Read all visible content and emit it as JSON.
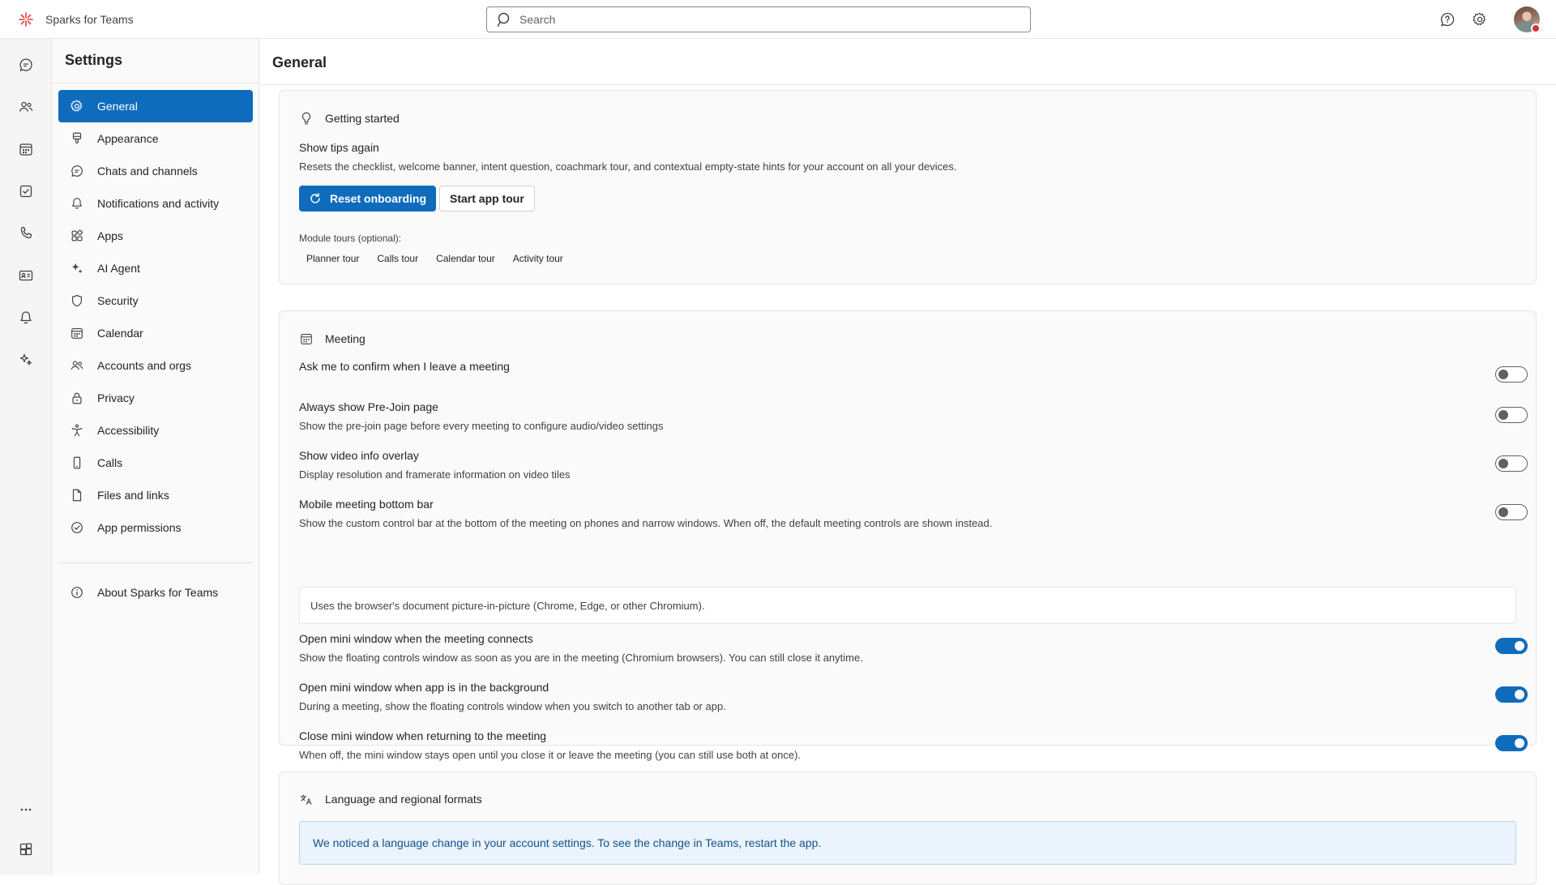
{
  "app": {
    "name": "Sparks for Teams"
  },
  "search": {
    "placeholder": "Search"
  },
  "settings_nav": {
    "title": "Settings",
    "items": [
      {
        "label": "General",
        "icon": "gear-icon",
        "active": true
      },
      {
        "label": "Appearance",
        "icon": "paintbrush-icon"
      },
      {
        "label": "Chats and channels",
        "icon": "chat-icon"
      },
      {
        "label": "Notifications and activity",
        "icon": "bell-icon"
      },
      {
        "label": "Apps",
        "icon": "apps-grid-icon"
      },
      {
        "label": "AI Agent",
        "icon": "sparkle-icon"
      },
      {
        "label": "Security",
        "icon": "shield-icon"
      },
      {
        "label": "Calendar",
        "icon": "calendar-icon"
      },
      {
        "label": "Accounts and orgs",
        "icon": "people-icon"
      },
      {
        "label": "Privacy",
        "icon": "lock-icon"
      },
      {
        "label": "Accessibility",
        "icon": "accessibility-icon"
      },
      {
        "label": "Calls",
        "icon": "phone-icon"
      },
      {
        "label": "Files and links",
        "icon": "document-icon"
      },
      {
        "label": "App permissions",
        "icon": "checkmark-circle-icon"
      }
    ],
    "about": {
      "label": "About Sparks for Teams",
      "icon": "info-icon"
    }
  },
  "main": {
    "title": "General"
  },
  "getting_started": {
    "heading": "Getting started",
    "tips_title": "Show tips again",
    "tips_desc": "Resets the checklist, welcome banner, intent question, coachmark tour, and contextual empty-state hints for your account on all your devices.",
    "reset_label": "Reset onboarding",
    "tour_label": "Start app tour",
    "module_label": "Module tours (optional):",
    "tours": [
      "Planner tour",
      "Calls tour",
      "Calendar tour",
      "Activity tour"
    ]
  },
  "meeting": {
    "heading": "Meeting",
    "settings": [
      {
        "title": "Ask me to confirm when I leave a meeting",
        "desc": "",
        "on": false
      },
      {
        "title": "Always show Pre-Join page",
        "desc": "Show the pre-join page before every meeting to configure audio/video settings",
        "on": false
      },
      {
        "title": "Show video info overlay",
        "desc": "Display resolution and framerate information on video tiles",
        "on": false
      },
      {
        "title": "Mobile meeting bottom bar",
        "desc": "Show the custom control bar at the bottom of the meeting on phones and narrow windows. When off, the default meeting controls are shown instead.",
        "on": false
      }
    ],
    "pip_note": "Uses the browser's document picture-in-picture (Chrome, Edge, or other Chromium).",
    "mini_settings": [
      {
        "title": "Open mini window when the meeting connects",
        "desc": "Show the floating controls window as soon as you are in the meeting (Chromium browsers). You can still close it anytime.",
        "on": true
      },
      {
        "title": "Open mini window when app is in the background",
        "desc": "During a meeting, show the floating controls window when you switch to another tab or app.",
        "on": true
      },
      {
        "title": "Close mini window when returning to the meeting",
        "desc": "When off, the mini window stays open until you close it or leave the meeting (you can still use both at once).",
        "on": true
      }
    ]
  },
  "language": {
    "heading": "Language and regional formats",
    "notice": "We noticed a language change in your account settings. To see the change in Teams, restart the app."
  },
  "colors": {
    "accent": "#0f6cbd",
    "danger": "#d13438"
  }
}
